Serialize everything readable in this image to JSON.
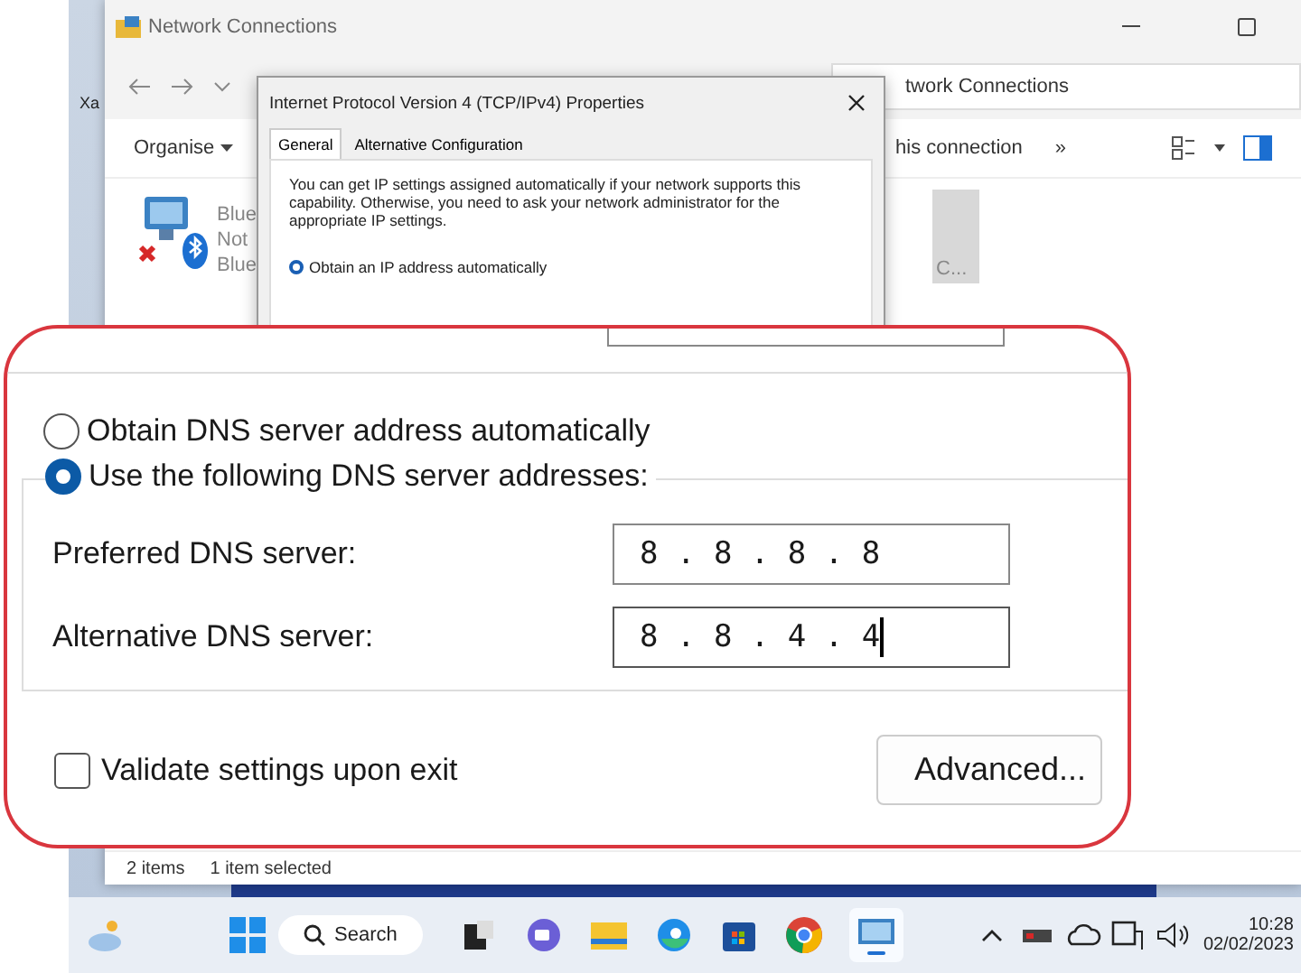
{
  "desktop": {
    "icon_label": "Xa"
  },
  "explorer": {
    "title": "Network Connections",
    "address": "twork Connections",
    "organise": "Organise",
    "command": "his connection",
    "more": "»",
    "items": [
      {
        "lines": [
          "Blue",
          "Not",
          "Blue"
        ],
        "selected": false
      },
      {
        "lines": [
          "C..."
        ],
        "selected": true
      }
    ],
    "status": [
      "2 items",
      "1 item selected"
    ]
  },
  "dialog": {
    "title": "Internet Protocol Version 4 (TCP/IPv4) Properties",
    "tabs": [
      {
        "label": "General",
        "selected": true
      },
      {
        "label": "Alternative Configuration",
        "selected": false
      }
    ],
    "intro": "You can get IP settings assigned automatically if your network supports this capability. Otherwise, you need to ask your network administrator for the appropriate IP settings.",
    "ip_options": [
      {
        "label": "Obtain an IP address automatically",
        "selected": true
      }
    ]
  },
  "callout": {
    "dns_options": [
      {
        "label": "Obtain DNS server address automatically",
        "selected": false
      },
      {
        "label": "Use the following DNS server addresses:",
        "selected": true
      }
    ],
    "fields": [
      {
        "label": "Preferred DNS server:",
        "value": "8 . 8 . 8 . 8",
        "focused": false
      },
      {
        "label": "Alternative DNS server:",
        "value": "8 . 8 . 4 . 4",
        "focused": true
      }
    ],
    "validate": {
      "label": "Validate settings upon exit",
      "checked": false
    },
    "advanced": "Advanced..."
  },
  "taskbar": {
    "search": "Search",
    "time": "10:28",
    "date": "02/02/2023"
  }
}
